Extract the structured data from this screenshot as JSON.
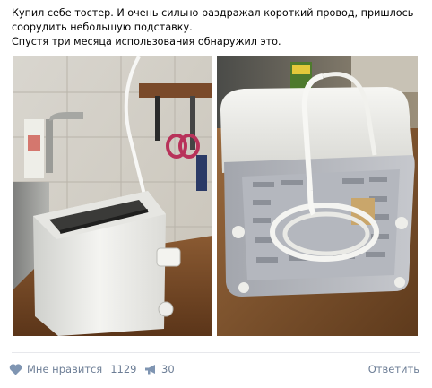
{
  "post": {
    "text_lines": [
      "Купил себе тостер. И очень сильно раздражал короткий провод, пришлось",
      "соорудить небольшую подставку.",
      "Спустя три месяца использования обнаружил это."
    ]
  },
  "photos": {
    "left": {
      "subject": "white toaster on kitchen counter with cord running up the wall"
    },
    "right": {
      "subject": "underside of toaster with cord wound into a stand"
    }
  },
  "footer": {
    "like_label": "Мне нравится",
    "like_count": "1129",
    "share_count": "30",
    "reply_label": "Ответить",
    "icons": {
      "like": "heart-icon",
      "share": "megaphone-icon"
    },
    "color": "#6d7e96"
  }
}
